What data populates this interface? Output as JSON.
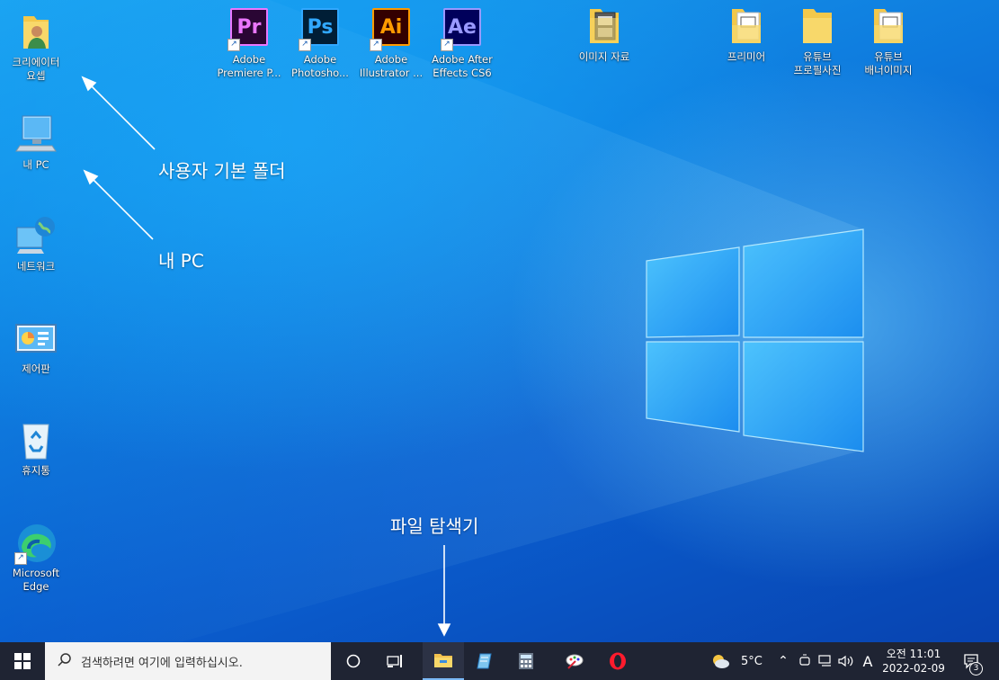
{
  "desktop": {
    "icons_left": [
      {
        "label": "크리에이터\n요셉"
      },
      {
        "label": "내 PC"
      },
      {
        "label": "네트워크"
      },
      {
        "label": "제어판"
      },
      {
        "label": "휴지통"
      },
      {
        "label": "Microsoft\nEdge"
      }
    ],
    "icons_top": [
      {
        "label": "Adobe\nPremiere P...",
        "abbr": "Pr",
        "color": "#ea77ff",
        "bg": "#2a0634"
      },
      {
        "label": "Adobe\nPhotosho...",
        "abbr": "Ps",
        "color": "#31a8ff",
        "bg": "#001e36"
      },
      {
        "label": "Adobe\nIllustrator ...",
        "abbr": "Ai",
        "color": "#ff9a00",
        "bg": "#330000"
      },
      {
        "label": "Adobe After\nEffects CS6",
        "abbr": "Ae",
        "color": "#9999ff",
        "bg": "#00005b"
      },
      {
        "label": "이미지 자료"
      },
      {
        "label": "프리미어"
      },
      {
        "label": "유튜브\n프로필사진"
      },
      {
        "label": "유튜브\n배너이미지"
      }
    ]
  },
  "annotations": {
    "user_folder": "사용자 기본 폴더",
    "my_pc": "내 PC",
    "file_explorer": "파일 탐색기"
  },
  "taskbar": {
    "search_placeholder": "검색하려면 여기에 입력하십시오.",
    "weather": "5°C",
    "ime": "A",
    "time": "오전 11:01",
    "date": "2022-02-09",
    "notification_count": "3"
  },
  "colors": {
    "taskbar_bg": "#1f2433",
    "desktop_accent": "#0a5fd0"
  }
}
